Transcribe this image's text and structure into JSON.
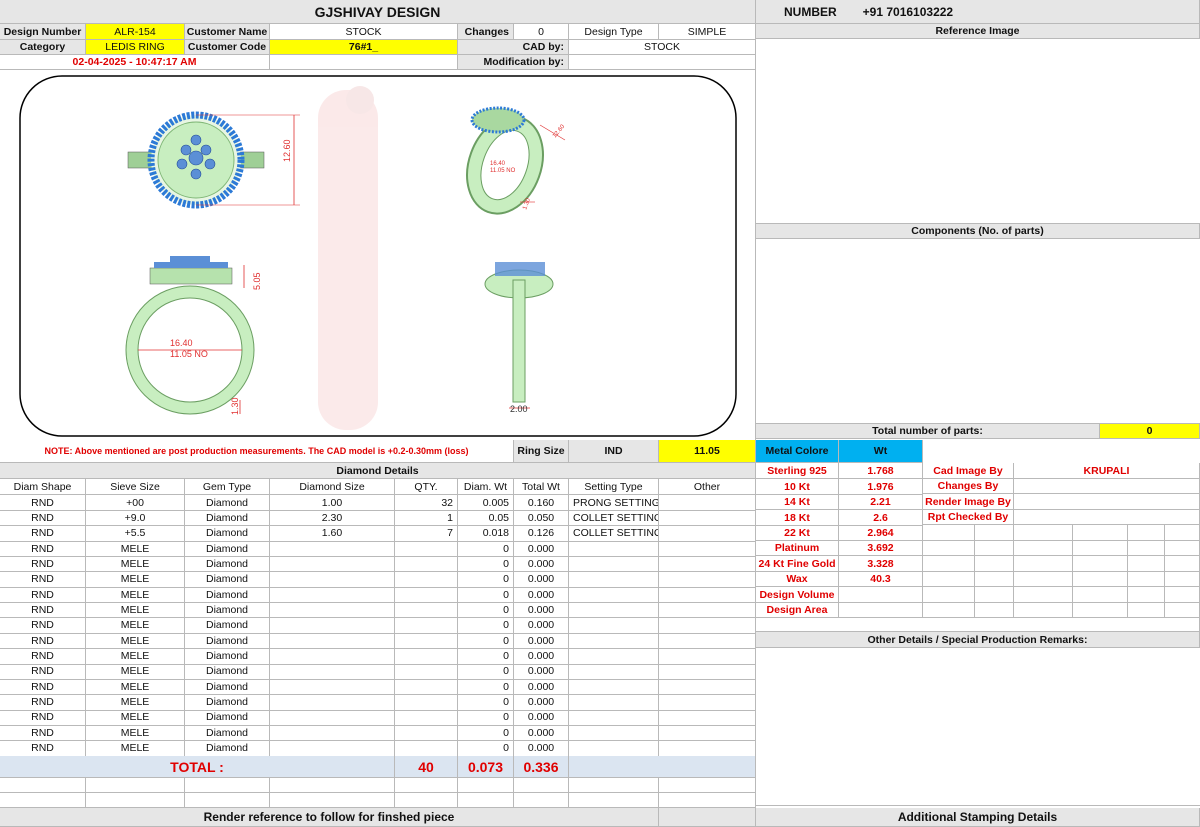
{
  "header": {
    "title": "GJSHIVAY DESIGN",
    "number_label": "NUMBER",
    "number_value": "+91 7016103222"
  },
  "info": {
    "design_number_label": "Design Number",
    "design_number": "ALR-154",
    "customer_name_label": "Customer Name",
    "customer_name": "STOCK",
    "changes_label": "Changes",
    "changes": "0",
    "design_type_label": "Design Type",
    "design_type": "SIMPLE",
    "category_label": "Category",
    "category": "LEDIS RING",
    "customer_code_label": "Customer Code",
    "customer_code": "76#1_",
    "cad_by_label": "CAD by:",
    "cad_by": "STOCK",
    "datetime": "02-04-2025 - 10:47:17 AM",
    "modification_label": "Modification by:"
  },
  "drawing": {
    "dim_height": "12.60",
    "dim_side_1": "5.05",
    "dim_inner": "16.40",
    "dim_size_no": "11.05 NO",
    "dim_band": "1.30",
    "dim_band_side": "2.00",
    "dim_persp_1": "16.40",
    "dim_persp_2": "11.05 NO",
    "dim_persp_3": "1.30",
    "dim_persp_4": "12.60"
  },
  "right_panel": {
    "reference_image": "Reference Image",
    "components": "Components (No. of parts)",
    "total_parts_label": "Total number of parts:",
    "total_parts": "0",
    "other_details": "Other Details / Special Production Remarks:",
    "additional_stamping": "Additional Stamping Details"
  },
  "note": {
    "text": "NOTE: Above mentioned are post production measurements. The CAD model is +0.2-0.30mm (loss)",
    "ring_size_label": "Ring Size",
    "ring_size_std": "IND",
    "ring_size_value": "11.05"
  },
  "metal": {
    "header_label": "Metal Colore",
    "header_wt": "Wt",
    "rows": [
      {
        "name": "Sterling 925",
        "wt": "1.768"
      },
      {
        "name": "10 Kt",
        "wt": "1.976"
      },
      {
        "name": "14 Kt",
        "wt": "2.21"
      },
      {
        "name": "18 Kt",
        "wt": "2.6"
      },
      {
        "name": "22 Kt",
        "wt": "2.964"
      },
      {
        "name": "Platinum",
        "wt": "3.692"
      },
      {
        "name": "24 Kt Fine Gold",
        "wt": "3.328"
      },
      {
        "name": "Wax",
        "wt": "40.3"
      },
      {
        "name": "Design Volume",
        "wt": ""
      },
      {
        "name": "Design Area",
        "wt": ""
      }
    ],
    "cad_image_by_label": "Cad Image By",
    "cad_image_by": "KRUPALI",
    "changes_by_label": "Changes By",
    "render_image_by_label": "Render Image By",
    "rpt_checked_by_label": "Rpt Checked By"
  },
  "diamond": {
    "title": "Diamond Details",
    "headers": [
      "Diam Shape",
      "Sieve Size",
      "Gem Type",
      "Diamond Size",
      "QTY.",
      "Diam. Wt",
      "Total Wt",
      "Setting Type",
      "Other"
    ],
    "rows": [
      [
        "RND",
        "+00",
        "Diamond",
        "1.00",
        "32",
        "0.005",
        "0.160",
        "PRONG SETTING",
        ""
      ],
      [
        "RND",
        "+9.0",
        "Diamond",
        "2.30",
        "1",
        "0.05",
        "0.050",
        "COLLET SETTING",
        ""
      ],
      [
        "RND",
        "+5.5",
        "Diamond",
        "1.60",
        "7",
        "0.018",
        "0.126",
        "COLLET SETTING",
        ""
      ],
      [
        "RND",
        "MELE",
        "Diamond",
        "",
        "",
        "0",
        "0.000",
        "",
        ""
      ],
      [
        "RND",
        "MELE",
        "Diamond",
        "",
        "",
        "0",
        "0.000",
        "",
        ""
      ],
      [
        "RND",
        "MELE",
        "Diamond",
        "",
        "",
        "0",
        "0.000",
        "",
        ""
      ],
      [
        "RND",
        "MELE",
        "Diamond",
        "",
        "",
        "0",
        "0.000",
        "",
        ""
      ],
      [
        "RND",
        "MELE",
        "Diamond",
        "",
        "",
        "0",
        "0.000",
        "",
        ""
      ],
      [
        "RND",
        "MELE",
        "Diamond",
        "",
        "",
        "0",
        "0.000",
        "",
        ""
      ],
      [
        "RND",
        "MELE",
        "Diamond",
        "",
        "",
        "0",
        "0.000",
        "",
        ""
      ],
      [
        "RND",
        "MELE",
        "Diamond",
        "",
        "",
        "0",
        "0.000",
        "",
        ""
      ],
      [
        "RND",
        "MELE",
        "Diamond",
        "",
        "",
        "0",
        "0.000",
        "",
        ""
      ],
      [
        "RND",
        "MELE",
        "Diamond",
        "",
        "",
        "0",
        "0.000",
        "",
        ""
      ],
      [
        "RND",
        "MELE",
        "Diamond",
        "",
        "",
        "0",
        "0.000",
        "",
        ""
      ],
      [
        "RND",
        "MELE",
        "Diamond",
        "",
        "",
        "0",
        "0.000",
        "",
        ""
      ],
      [
        "RND",
        "MELE",
        "Diamond",
        "",
        "",
        "0",
        "0.000",
        "",
        ""
      ],
      [
        "RND",
        "MELE",
        "Diamond",
        "",
        "",
        "0",
        "0.000",
        "",
        ""
      ]
    ],
    "total_label": "TOTAL :",
    "total_qty": "40",
    "total_diam_wt": "0.073",
    "total_wt": "0.336"
  },
  "footer": {
    "render_reference": "Render reference to follow for finshed piece"
  },
  "colors": {
    "ring_green": "#c8eec0",
    "stone_blue": "#5b8fd6",
    "dim_red": "#e03030",
    "highlight_yellow": "#ffff00",
    "header_blue": "#00b0f0"
  }
}
